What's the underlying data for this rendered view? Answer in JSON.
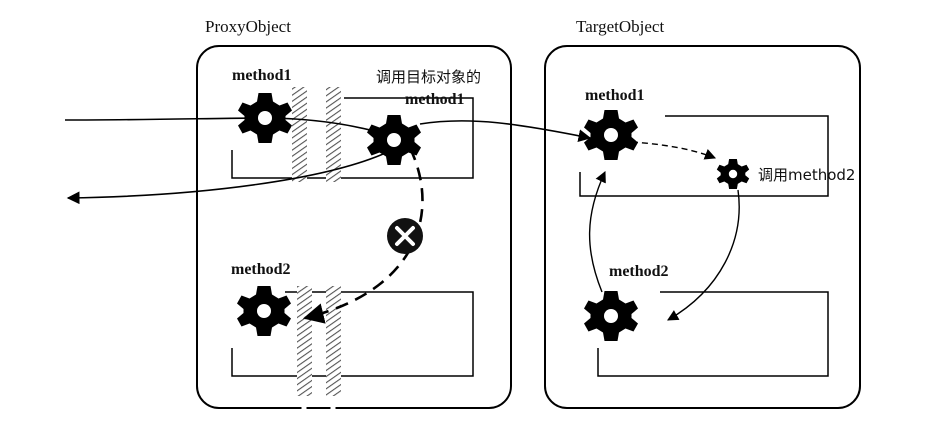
{
  "proxy": {
    "title": "ProxyObject",
    "method1_label": "method1",
    "call_label_line1": "调用目标对象的",
    "call_label_line2": "method1",
    "method2_label": "method2"
  },
  "target": {
    "title": "TargetObject",
    "method1_label": "method1",
    "call_method2_label": "调用method2",
    "method2_label": "method2"
  },
  "icons": {
    "gear": "gear-icon",
    "block": "cross-circle-icon"
  }
}
